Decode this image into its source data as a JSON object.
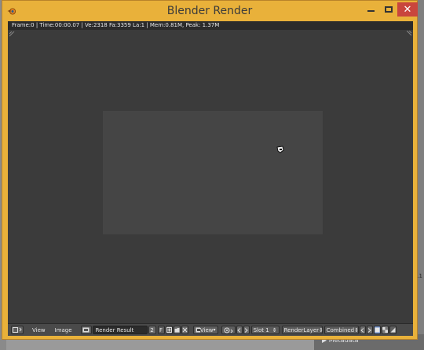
{
  "window": {
    "title": "Blender Render",
    "close_glyph": "✕"
  },
  "info_bar": {
    "text": "Frame:0 | Time:00:00.07 | Ve:2318 Fa:3359 La:1 | Mem:0.81M, Peak: 1.37M"
  },
  "header": {
    "menu_view": "View",
    "menu_image": "Image",
    "image_name": "Render Result",
    "users_count": "2",
    "fake_user": "F",
    "view_label": "View",
    "slot": "Slot 1",
    "render_layer": "RenderLayer",
    "render_pass": "Combined",
    "spinner_glyph": "⇕"
  },
  "background": {
    "metadata_label": "▶ Metadata",
    "side_number": "11"
  },
  "colors": {
    "title_bar": "#e9b13a",
    "close_button": "#c9463d",
    "viewport": "#3b3b3b",
    "render_image": "#454545"
  }
}
